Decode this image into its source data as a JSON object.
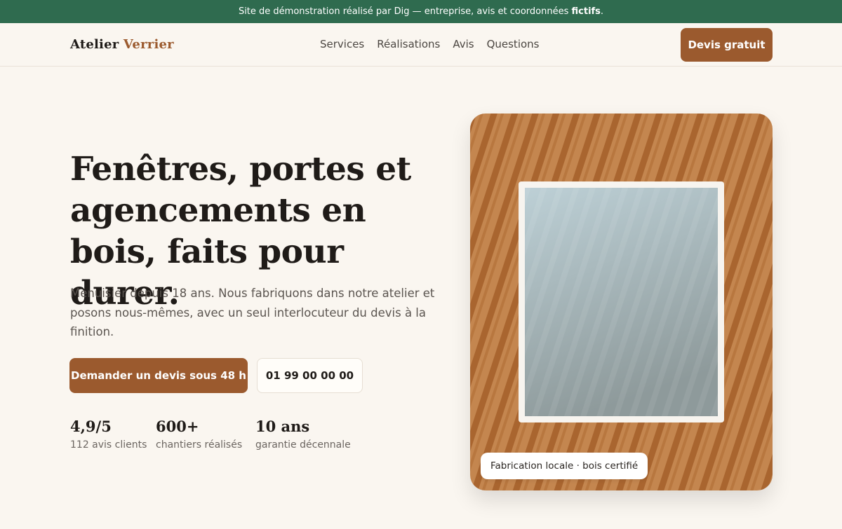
{
  "topbar": {
    "text": "Site de démonstration réalisé par Dig — entreprise, avis et coordonnées ",
    "strong": "fictifs",
    "suffix": "."
  },
  "brand": {
    "name_part1": "Atelier",
    "name_part2": "Verrier"
  },
  "nav": {
    "items": [
      "Services",
      "Réalisations",
      "Avis",
      "Questions"
    ],
    "cta_label": "Devis gratuit"
  },
  "hero": {
    "title": "Fenêtres, portes et agencements en bois, faits pour durer.",
    "description": "Menuisier depuis 18 ans. Nous fabriquons dans notre atelier et posons nous-mêmes, avec un seul interlocuteur du devis à la finition.",
    "primary_button": "Demander un devis sous 48 h",
    "phone_button": "01 99 00 00 00",
    "stats": [
      {
        "value": "4,9/5",
        "label": "112 avis clients"
      },
      {
        "value": "600+",
        "label": "chantiers réalisés"
      },
      {
        "value": "10 ans",
        "label": "garantie décennale"
      }
    ],
    "visual_caption": "Fabrication locale · bois certifié"
  },
  "colors": {
    "topbar": "#2f6b4f",
    "accent": "#9b5a2e",
    "background": "#faf6f0",
    "wood_light": "#c88a58",
    "wood_dark": "#a7622f"
  }
}
